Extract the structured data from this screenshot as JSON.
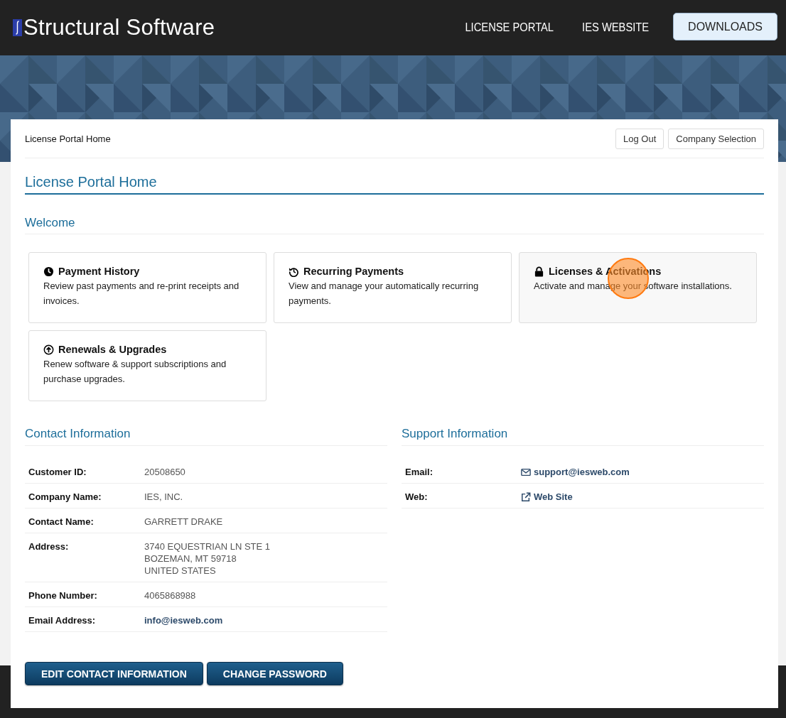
{
  "header": {
    "logo_text": "Structural Software",
    "nav": [
      {
        "label": "LICENSE PORTAL",
        "kind": "link"
      },
      {
        "label": "IES WEBSITE",
        "kind": "link"
      },
      {
        "label": "DOWNLOADS",
        "kind": "button"
      }
    ]
  },
  "breadcrumb": "License Portal Home",
  "top_buttons": [
    "Log Out",
    "Company Selection"
  ],
  "page_title": "License Portal Home",
  "welcome_title": "Welcome",
  "cards": [
    {
      "kind": "clock",
      "title": "Payment History",
      "description": "Review past payments and re-print receipts and invoices.",
      "hovered": false
    },
    {
      "kind": "history",
      "title": "Recurring Payments",
      "description": "View and manage your automatically recurring payments.",
      "hovered": false
    },
    {
      "kind": "lock",
      "title": "Licenses & Activations",
      "description": "Activate and manage your software installations.",
      "hovered": true
    },
    {
      "kind": "upload",
      "title": "Renewals & Upgrades",
      "description": "Renew software & support subscriptions and purchase upgrades.",
      "hovered": false
    }
  ],
  "contact": {
    "title": "Contact Information",
    "rows": [
      {
        "label": "Customer ID:",
        "kind": "text",
        "lines": [
          "20508650"
        ]
      },
      {
        "label": "Company Name:",
        "kind": "text",
        "lines": [
          "IES, INC."
        ]
      },
      {
        "label": "Contact Name:",
        "kind": "text",
        "lines": [
          "GARRETT DRAKE"
        ]
      },
      {
        "label": "Address:",
        "kind": "text",
        "lines": [
          "3740 EQUESTRIAN LN STE 1",
          "BOZEMAN, MT 59718",
          "UNITED STATES"
        ]
      },
      {
        "label": "Phone Number:",
        "kind": "text",
        "lines": [
          "4065868988"
        ]
      },
      {
        "label": "Email Address:",
        "kind": "link",
        "lines": [
          "info@iesweb.com"
        ]
      }
    ]
  },
  "support": {
    "title": "Support Information",
    "rows": [
      {
        "label": "Email:",
        "kind": "email",
        "lines": [
          "support@iesweb.com"
        ]
      },
      {
        "label": "Web:",
        "kind": "web",
        "lines": [
          "Web Site"
        ]
      }
    ]
  },
  "buttons": [
    "EDIT CONTACT INFORMATION",
    "CHANGE PASSWORD"
  ]
}
